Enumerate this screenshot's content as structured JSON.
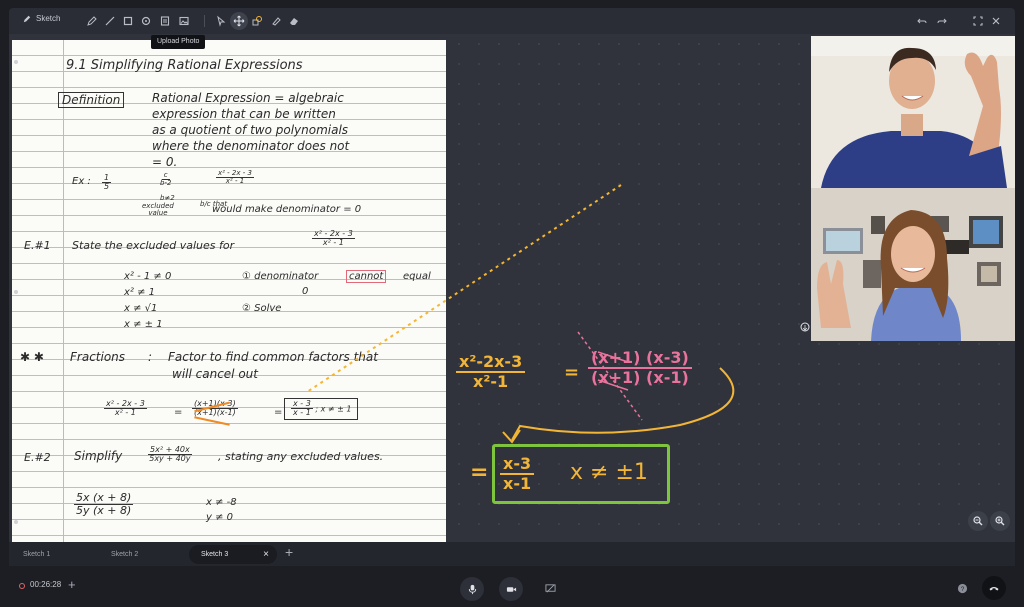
{
  "toolbar": {
    "title": "Sketch",
    "tooltip": "Upload Photo",
    "tools": [
      {
        "name": "pencil-icon"
      },
      {
        "name": "line-icon"
      },
      {
        "name": "square-icon"
      },
      {
        "name": "target-icon"
      },
      {
        "name": "document-icon"
      },
      {
        "name": "image-icon"
      },
      {
        "name": "pointer-icon"
      },
      {
        "name": "move-icon"
      },
      {
        "name": "shapes-icon"
      },
      {
        "name": "highlighter-icon"
      },
      {
        "name": "eraser-icon"
      }
    ],
    "right_tools": [
      {
        "name": "undo-icon"
      },
      {
        "name": "redo-icon"
      },
      {
        "name": "fullscreen-icon"
      },
      {
        "name": "close-icon"
      }
    ]
  },
  "notes": {
    "title": "9.1 Simplifying Rational Expressions",
    "definition_label": "Definition",
    "definition_lines": [
      "Rational Expression = algebraic",
      "expression that can be written",
      "as a quotient of two polynomials",
      "where the denominator does not",
      "= 0."
    ],
    "ex_label": "Ex :",
    "ex_frac1_num": "1",
    "ex_frac1_den": "5",
    "ex_frac2_num": "c",
    "ex_frac2_den": "b-2",
    "ex_frac3_num": "x² - 2x - 3",
    "ex_frac3_den": "x² - 1",
    "ex_bne2": "b≠2",
    "excluded_value": "excluded\nvalue",
    "that_note": "b/c that",
    "would_make": "would make denominator = 0",
    "ex1_label": "E.#1",
    "ex1_text": "State the excluded values for",
    "ex1_frac_num": "x² - 2x - 3",
    "ex1_frac_den": "x² - 1",
    "ex1_steps": [
      "x² - 1 ≠ 0",
      "x² ≠ 1",
      "x ≠ √1",
      "x ≠ ± 1"
    ],
    "ex1_note1_pre": "① denominator",
    "ex1_note1_word": "cannot",
    "ex1_note1_post": "equal",
    "ex1_note1_zero": "0",
    "ex1_note2": "② Solve",
    "fractions_star": "✱ ✱",
    "fractions_label": "Fractions",
    "fractions_colon": ":",
    "fractions_text1": "Factor to find common factors that",
    "fractions_text2": "will cancel out",
    "frac_a_num": "x² - 2x - 3",
    "frac_a_den": "x² - 1",
    "frac_b_num": "(x+1)(x-3)",
    "frac_b_den": "(x+1)(x-1)",
    "frac_c_num": "x - 3",
    "frac_c_den": "x - 1",
    "frac_c_cond": "; x ≠ ± 1",
    "equals": "=",
    "ex2_label": "E.#2",
    "ex2_text": "Simplify",
    "ex2_frac_num": "5x² + 40x",
    "ex2_frac_den": "5xy + 40y",
    "ex2_text2": ", stating any excluded values.",
    "ex2_work_num": "5x (x + 8)",
    "ex2_work_den": "5y (x + 8)",
    "ex2_cond1": "x ≠ -8",
    "ex2_cond2": "y ≠ 0"
  },
  "whiteboard": {
    "lhs_num": "x²-2x-3",
    "lhs_den": "x²-1",
    "eq1": "=",
    "rhs_num": "(x+1) (x-3)",
    "rhs_den": "(x+1) (x-1)",
    "eq2": "=",
    "ans_num": "x-3",
    "ans_den": "x-1",
    "ans_cond": "x ≠ ±1"
  },
  "colors": {
    "yellow_ink": "#f3b536",
    "pink_ink": "#e9739c",
    "green_box": "#7fc43d",
    "canvas": "#30333b"
  },
  "tabs": [
    {
      "label": "Sketch 1"
    },
    {
      "label": "Sketch 2"
    },
    {
      "label": "Sketch 3"
    }
  ],
  "bottom": {
    "timer": "00:26:28"
  }
}
